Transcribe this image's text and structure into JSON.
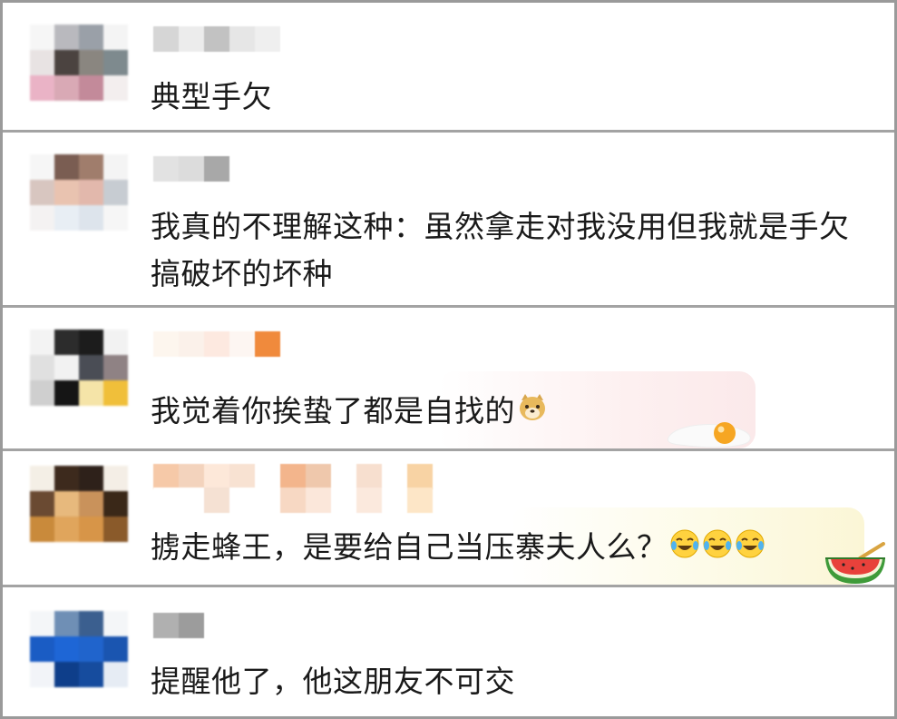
{
  "comments": [
    {
      "text": "典型手欠"
    },
    {
      "text": "我真的不理解这种：虽然拿走对我没用但我就是手欠搞破坏的坏种"
    },
    {
      "text": "我觉着你挨蛰了都是自找的"
    },
    {
      "text": "掳走蜂王，是要给自己当压寨夫人么？"
    },
    {
      "text": "提醒他了，他这朋友不可交"
    }
  ],
  "icons": {
    "c3_emoji": "doge-emoji-icon",
    "c3_deco": "fried-egg-icon",
    "c4_emoji": "laugh-cry-emoji-icon",
    "c4_deco": "watermelon-icon"
  },
  "colors": {
    "separator": "#a3a3a3",
    "text": "#1a1a1a"
  }
}
